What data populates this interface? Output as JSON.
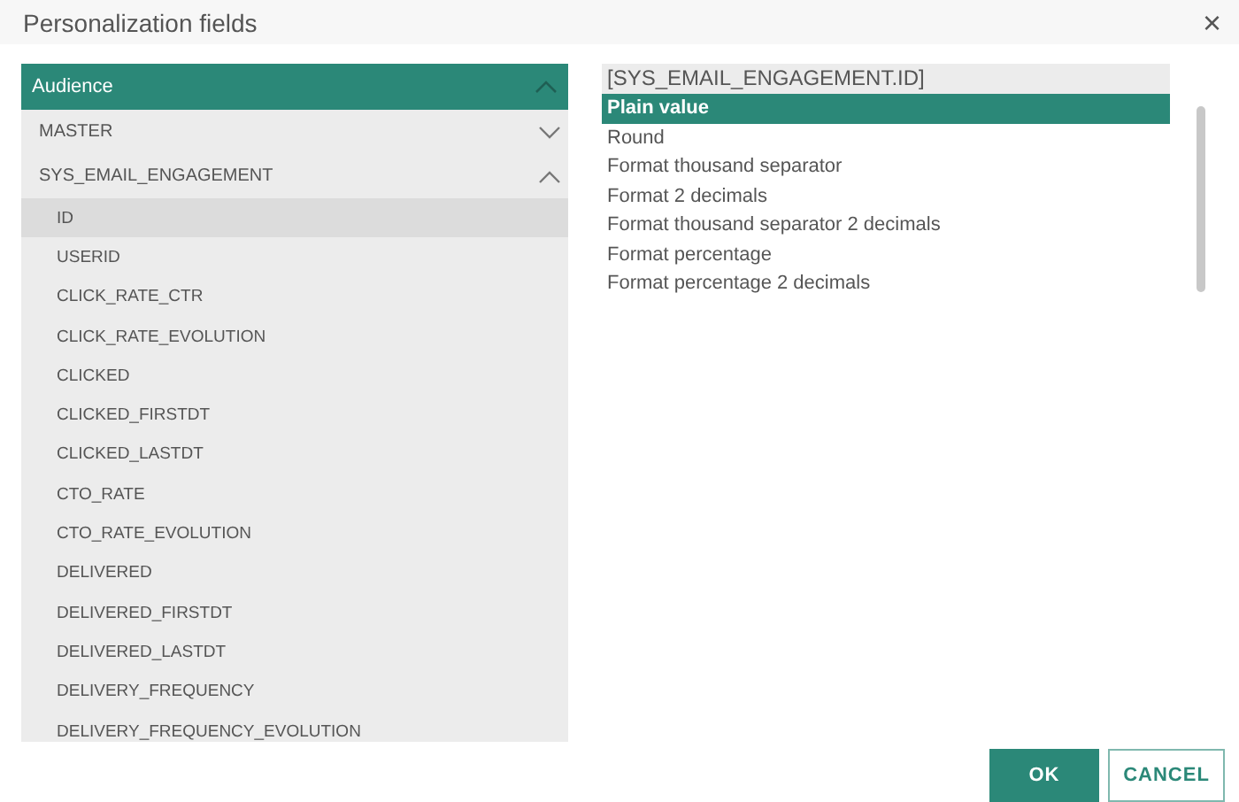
{
  "window": {
    "title": "Personalization fields",
    "close": "×"
  },
  "tree": {
    "label": "Audience",
    "expanded": true,
    "children": [
      {
        "label": "MASTER",
        "expanded": false
      },
      {
        "label": "SYS_EMAIL_ENGAGEMENT",
        "expanded": true,
        "children": [
          {
            "label": "ID",
            "selected": true
          },
          {
            "label": "USERID",
            "selected": false
          },
          {
            "label": "CLICK_RATE_CTR",
            "selected": false
          },
          {
            "label": "CLICK_RATE_EVOLUTION",
            "selected": false
          },
          {
            "label": "CLICKED",
            "selected": false
          },
          {
            "label": "CLICKED_FIRSTDT",
            "selected": false
          },
          {
            "label": "CLICKED_LASTDT",
            "selected": false
          },
          {
            "label": "CTO_RATE",
            "selected": false
          },
          {
            "label": "CTO_RATE_EVOLUTION",
            "selected": false
          },
          {
            "label": "DELIVERED",
            "selected": false
          },
          {
            "label": "DELIVERED_FIRSTDT",
            "selected": false
          },
          {
            "label": "DELIVERED_LASTDT",
            "selected": false
          },
          {
            "label": "DELIVERY_FREQUENCY",
            "selected": false
          },
          {
            "label": "DELIVERY_FREQUENCY_EVOLUTION",
            "selected": false
          }
        ]
      }
    ]
  },
  "format_list": {
    "field": "[SYS_EMAIL_ENGAGEMENT.ID]",
    "options": [
      {
        "label": "Plain value",
        "selected": true
      },
      {
        "label": "Round",
        "selected": false
      },
      {
        "label": "Format thousand separator",
        "selected": false
      },
      {
        "label": "Format 2 decimals",
        "selected": false
      },
      {
        "label": "Format thousand separator 2 decimals",
        "selected": false
      },
      {
        "label": "Format percentage",
        "selected": false
      },
      {
        "label": "Format percentage 2 decimals",
        "selected": false
      }
    ]
  },
  "buttons": [
    {
      "label": "OK",
      "kind": "primary"
    },
    {
      "label": "CANCEL",
      "kind": "secondary"
    }
  ]
}
